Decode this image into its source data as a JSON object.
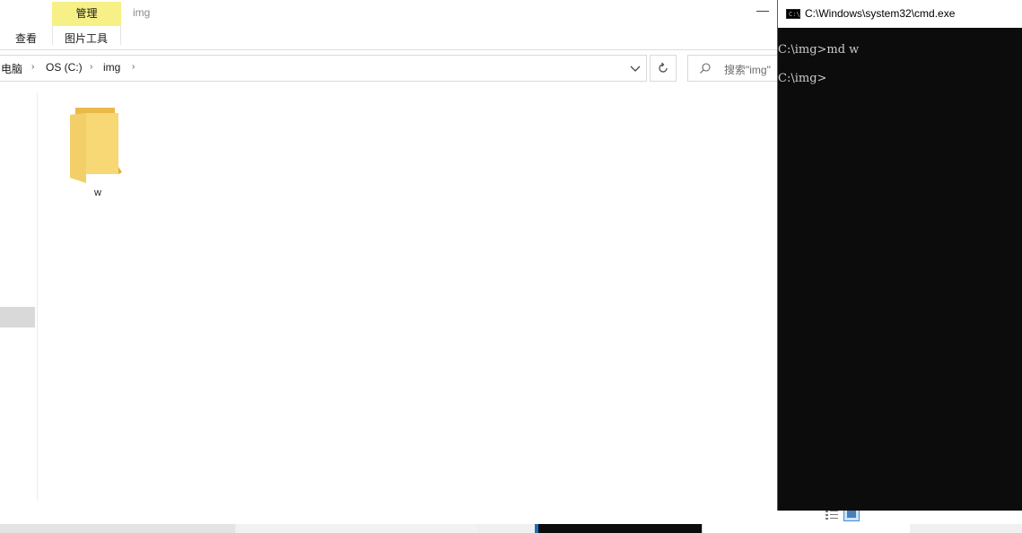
{
  "explorer": {
    "window_title": "img",
    "ribbon": {
      "context_group": "管理",
      "tabs": [
        {
          "label": "查看"
        },
        {
          "label": "图片工具"
        }
      ]
    },
    "breadcrumb": [
      {
        "label": "电脑"
      },
      {
        "label": "OS (C:)"
      },
      {
        "label": "img"
      }
    ],
    "search": {
      "placeholder": "搜索\"img\""
    },
    "items": [
      {
        "name": "w",
        "type": "folder"
      }
    ],
    "colors": {
      "context_tab": "#f6f087",
      "folder": "#f8d775"
    }
  },
  "cmd": {
    "title": "C:\\Windows\\system32\\cmd.exe",
    "lines": [
      "C:\\img>md w",
      "C:\\img>"
    ],
    "colors": {
      "background": "#0c0c0c",
      "text": "#cccccc"
    }
  }
}
